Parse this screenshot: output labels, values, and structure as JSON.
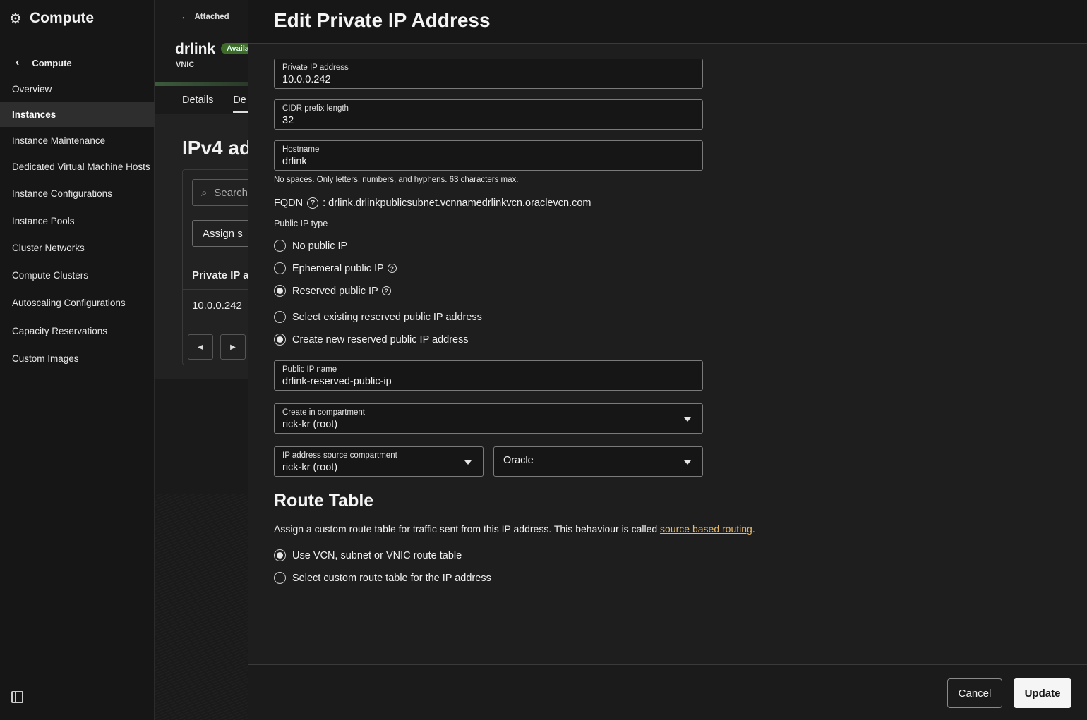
{
  "sidebar": {
    "title": "Compute",
    "back_label": "Compute",
    "items": [
      {
        "label": "Overview",
        "active": false
      },
      {
        "label": "Instances",
        "active": true
      },
      {
        "label": "Instance Maintenance",
        "active": false
      },
      {
        "label": "Dedicated Virtual Machine Hosts",
        "active": false
      },
      {
        "label": "Instance Configurations",
        "active": false
      },
      {
        "label": "Instance Pools",
        "active": false
      },
      {
        "label": "Cluster Networks",
        "active": false
      },
      {
        "label": "Compute Clusters",
        "active": false
      },
      {
        "label": "Autoscaling Configurations",
        "active": false
      },
      {
        "label": "Capacity Reservations",
        "active": false
      },
      {
        "label": "Custom Images",
        "active": false
      }
    ]
  },
  "background": {
    "attached_label": "Attached",
    "resource_name": "drlink",
    "status_badge": "Availa",
    "resource_type": "VNIC",
    "tabs": [
      "Details",
      "De"
    ],
    "section_title": "IPv4 ad",
    "search_placeholder": "Search",
    "assign_button": "Assign s",
    "column_header": "Private IP a",
    "row_value": "10.0.0.242"
  },
  "drawer": {
    "title": "Edit Private IP Address",
    "private_ip": {
      "label": "Private IP address",
      "value": "10.0.0.242"
    },
    "cidr": {
      "label": "CIDR prefix length",
      "value": "32"
    },
    "hostname": {
      "label": "Hostname",
      "value": "drlink",
      "help": "No spaces. Only letters, numbers, and hyphens. 63 characters max."
    },
    "fqdn": {
      "label": "FQDN",
      "value": ": drlink.drlinkpublicsubnet.vcnnamedrlinkvcn.oraclevcn.com"
    },
    "public_ip_type": {
      "label": "Public IP type",
      "options": [
        {
          "label": "No public IP",
          "selected": false
        },
        {
          "label": "Ephemeral public IP",
          "selected": false
        },
        {
          "label": "Reserved public IP",
          "selected": true
        }
      ]
    },
    "reserved_source": {
      "options": [
        {
          "label": "Select existing reserved public IP address",
          "selected": false
        },
        {
          "label": "Create new reserved public IP address",
          "selected": true
        }
      ]
    },
    "public_ip_name": {
      "label": "Public IP name",
      "value": "drlink-reserved-public-ip"
    },
    "create_compartment": {
      "label": "Create in compartment",
      "value": "rick-kr (root)"
    },
    "source_compartment": {
      "label": "IP address source compartment",
      "value": "rick-kr (root)"
    },
    "ip_pool": {
      "value": "Oracle"
    },
    "route_table": {
      "title": "Route Table",
      "description": "Assign a custom route table for traffic sent from this IP address. This behaviour is called ",
      "link": "source based routing",
      "description_end": ".",
      "options": [
        {
          "label": "Use VCN, subnet or VNIC route table",
          "selected": true
        },
        {
          "label": "Select custom route table for the IP address",
          "selected": false
        }
      ]
    },
    "footer": {
      "cancel": "Cancel",
      "update": "Update"
    }
  },
  "colors": {
    "link": "#e6b86a",
    "badge": "#3f6b2a",
    "active_nav": "#2e2e2e"
  }
}
